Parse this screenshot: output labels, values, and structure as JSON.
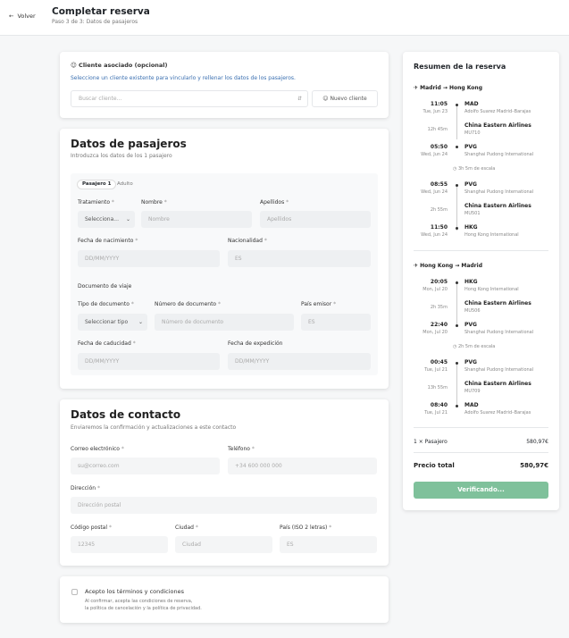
{
  "header": {
    "back_label": "Volver",
    "title": "Completar reserva",
    "subtitle": "Paso 3 de 3: Datos de pasajeros"
  },
  "client": {
    "title": "Cliente asociado (opcional)",
    "help": "Seleccione un cliente existente para vincularlo y rellenar los datos de los pasajeros.",
    "search_placeholder": "Buscar cliente...",
    "new_client_label": "Nuevo cliente"
  },
  "passengers": {
    "title": "Datos de pasajeros",
    "subtitle": "Introduzca los datos de los 1 pasajero",
    "tab_label": "Pasajero 1",
    "tab_type": "Adulto",
    "treatment_label": "Tratamiento",
    "treatment_value": "Selecciona...",
    "name_label": "Nombre",
    "name_placeholder": "Nombre",
    "surname_label": "Apellidos",
    "surname_placeholder": "Apellidos",
    "birth_label": "Fecha de nacimiento",
    "birth_placeholder": "DD/MM/YYYY",
    "nationality_label": "Nacionalidad",
    "nationality_placeholder": "ES",
    "doc_section": "Documento de viaje",
    "doc_type_label": "Tipo de documento",
    "doc_type_value": "Seleccionar tipo",
    "doc_number_label": "Número de documento",
    "doc_number_placeholder": "Número de documento",
    "issuer_label": "País emisor",
    "issuer_placeholder": "ES",
    "expiry_label": "Fecha de caducidad",
    "expiry_placeholder": "DD/MM/YYYY",
    "issue_label": "Fecha de expedición",
    "issue_placeholder": "DD/MM/YYYY"
  },
  "contact": {
    "title": "Datos de contacto",
    "subtitle": "Enviaremos la confirmación y actualizaciones a este contacto",
    "email_label": "Correo electrónico",
    "email_placeholder": "su@correo.com",
    "phone_label": "Teléfono",
    "phone_placeholder": "+34 600 000 000",
    "address_label": "Dirección",
    "address_placeholder": "Dirección postal",
    "zip_label": "Código postal",
    "zip_placeholder": "12345",
    "city_label": "Ciudad",
    "city_placeholder": "Ciudad",
    "country_label": "País (ISO 2 letras)",
    "country_placeholder": "ES"
  },
  "terms": {
    "label": "Acepto los términos y condiciones",
    "line1": "Al confirmar, acepta las condiciones de reserva,",
    "line2": "la política de cancelación y la política de privacidad."
  },
  "summary": {
    "title": "Resumen de la reserva",
    "outbound": {
      "route": "Madrid → Hong Kong",
      "seg1": {
        "dep_time": "11:05",
        "dep_date": "Tue, Jun 23",
        "dep_code": "MAD",
        "dep_airport": "Adolfo Suarez Madrid–Barajas",
        "duration": "12h 45m",
        "airline": "China Eastern Airlines",
        "flight": "MU710",
        "arr_time": "05:50",
        "arr_date": "Wed, Jun 24",
        "arr_code": "PVG",
        "arr_airport": "Shanghai Pudong International"
      },
      "layover": "3h 5m de escala",
      "seg2": {
        "dep_time": "08:55",
        "dep_date": "Wed, Jun 24",
        "dep_code": "PVG",
        "dep_airport": "Shanghai Pudong International",
        "duration": "2h 55m",
        "airline": "China Eastern Airlines",
        "flight": "MU501",
        "arr_time": "11:50",
        "arr_date": "Wed, Jun 24",
        "arr_code": "HKG",
        "arr_airport": "Hong Kong International"
      }
    },
    "inbound": {
      "route": "Hong Kong → Madrid",
      "seg1": {
        "dep_time": "20:05",
        "dep_date": "Mon, Jul 20",
        "dep_code": "HKG",
        "dep_airport": "Hong Kong International",
        "duration": "2h 35m",
        "airline": "China Eastern Airlines",
        "flight": "MU506",
        "arr_time": "22:40",
        "arr_date": "Mon, Jul 20",
        "arr_code": "PVG",
        "arr_airport": "Shanghai Pudong International"
      },
      "layover": "2h 5m de escala",
      "seg2": {
        "dep_time": "00:45",
        "dep_date": "Tue, Jul 21",
        "dep_code": "PVG",
        "dep_airport": "Shanghai Pudong International",
        "duration": "13h 55m",
        "airline": "China Eastern Airlines",
        "flight": "MU709",
        "arr_time": "08:40",
        "arr_date": "Tue, Jul 21",
        "arr_code": "MAD",
        "arr_airport": "Adolfo Suarez Madrid–Barajas"
      }
    },
    "passengers_label": "1 × Pasajero",
    "passengers_price": "580,97€",
    "total_label": "Precio total",
    "total_price": "580,97€",
    "button_label": "Verificando..."
  },
  "colors": {
    "accent": "#7fc19b"
  }
}
